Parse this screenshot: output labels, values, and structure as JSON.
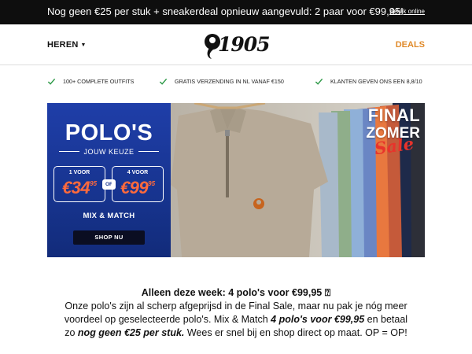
{
  "topbar": {
    "message": "Nog geen €25 per stuk + sneakerdeal opnieuw aangevuld: 2 paar voor €99,95!",
    "link": "Bekijk online"
  },
  "header": {
    "nav_left": "HEREN",
    "logo_text": "1905",
    "nav_right": "DEALS"
  },
  "usps": [
    "100+ COMPLETE OUTFITS",
    "GRATIS VERZENDING IN NL VANAF €150",
    "KLANTEN GEVEN ONS EEN 8,8/10"
  ],
  "hero": {
    "title": "POLO'S",
    "subtitle": "JOUW KEUZE",
    "offer1": {
      "label": "1 VOOR",
      "price_main": "€34",
      "price_cents": "95"
    },
    "offer2": {
      "label": "4 VOOR",
      "price_main": "€99",
      "price_cents": "95"
    },
    "or_label": "OF",
    "mix_label": "MIX & MATCH",
    "cta": "SHOP NU",
    "sale_line1": "FINAL",
    "sale_line2": "ZOMER",
    "sale_line3": "Sale"
  },
  "copy": {
    "headline": "Alleen deze week: 4 polo's voor €99,95 ⍰",
    "text1": "Onze polo's zijn al scherp afgeprijsd in de Final Sale, maar nu pak je nóg meer voordeel op geselecteerde polo's. Mix & Match ",
    "em1": "4 polo's voor €99,95",
    "text2": " en betaal zo ",
    "em2": "nog geen €25 per stuk.",
    "text3": " Wees er snel bij en shop direct op maat. OP = OP!"
  },
  "colors": {
    "topbar_bg": "#0e0e0e",
    "deals": "#e08a2a",
    "check": "#2e9a48",
    "hero_blue": "#1f3ea8",
    "price_orange": "#ff6a3c",
    "sale_red": "#e8332b"
  },
  "icons": {
    "usp_icon": "check-icon",
    "logo_icon": "logo-mark-icon"
  }
}
